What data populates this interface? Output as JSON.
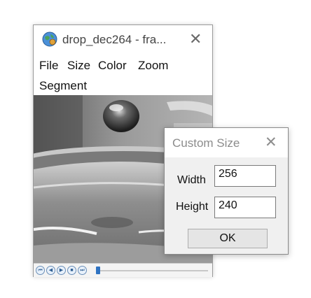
{
  "player_window": {
    "title": "drop_dec264 - fra...",
    "close_glyph": "✕",
    "app_icon": "globe-icon",
    "menu": [
      {
        "label": "File"
      },
      {
        "label": "Size"
      },
      {
        "label": "Color"
      },
      {
        "label": "Zoom"
      },
      {
        "label": "Segment"
      }
    ],
    "controls": {
      "buttons": [
        {
          "icon": "skip-to-start-icon",
          "glyph": "⏮"
        },
        {
          "icon": "step-back-icon",
          "glyph": "◀"
        },
        {
          "icon": "play-icon",
          "glyph": "▶"
        },
        {
          "icon": "stop-icon",
          "glyph": "■"
        },
        {
          "icon": "skip-to-end-icon",
          "glyph": "⏭"
        }
      ],
      "seek_position": 0
    }
  },
  "dialog": {
    "title": "Custom Size",
    "close_glyph": "✕",
    "width_label": "Width",
    "width_value": "256",
    "height_label": "Height",
    "height_value": "240",
    "ok_label": "OK"
  },
  "colors": {
    "accent": "#2f73c2",
    "control_border": "#6b8fb8"
  }
}
